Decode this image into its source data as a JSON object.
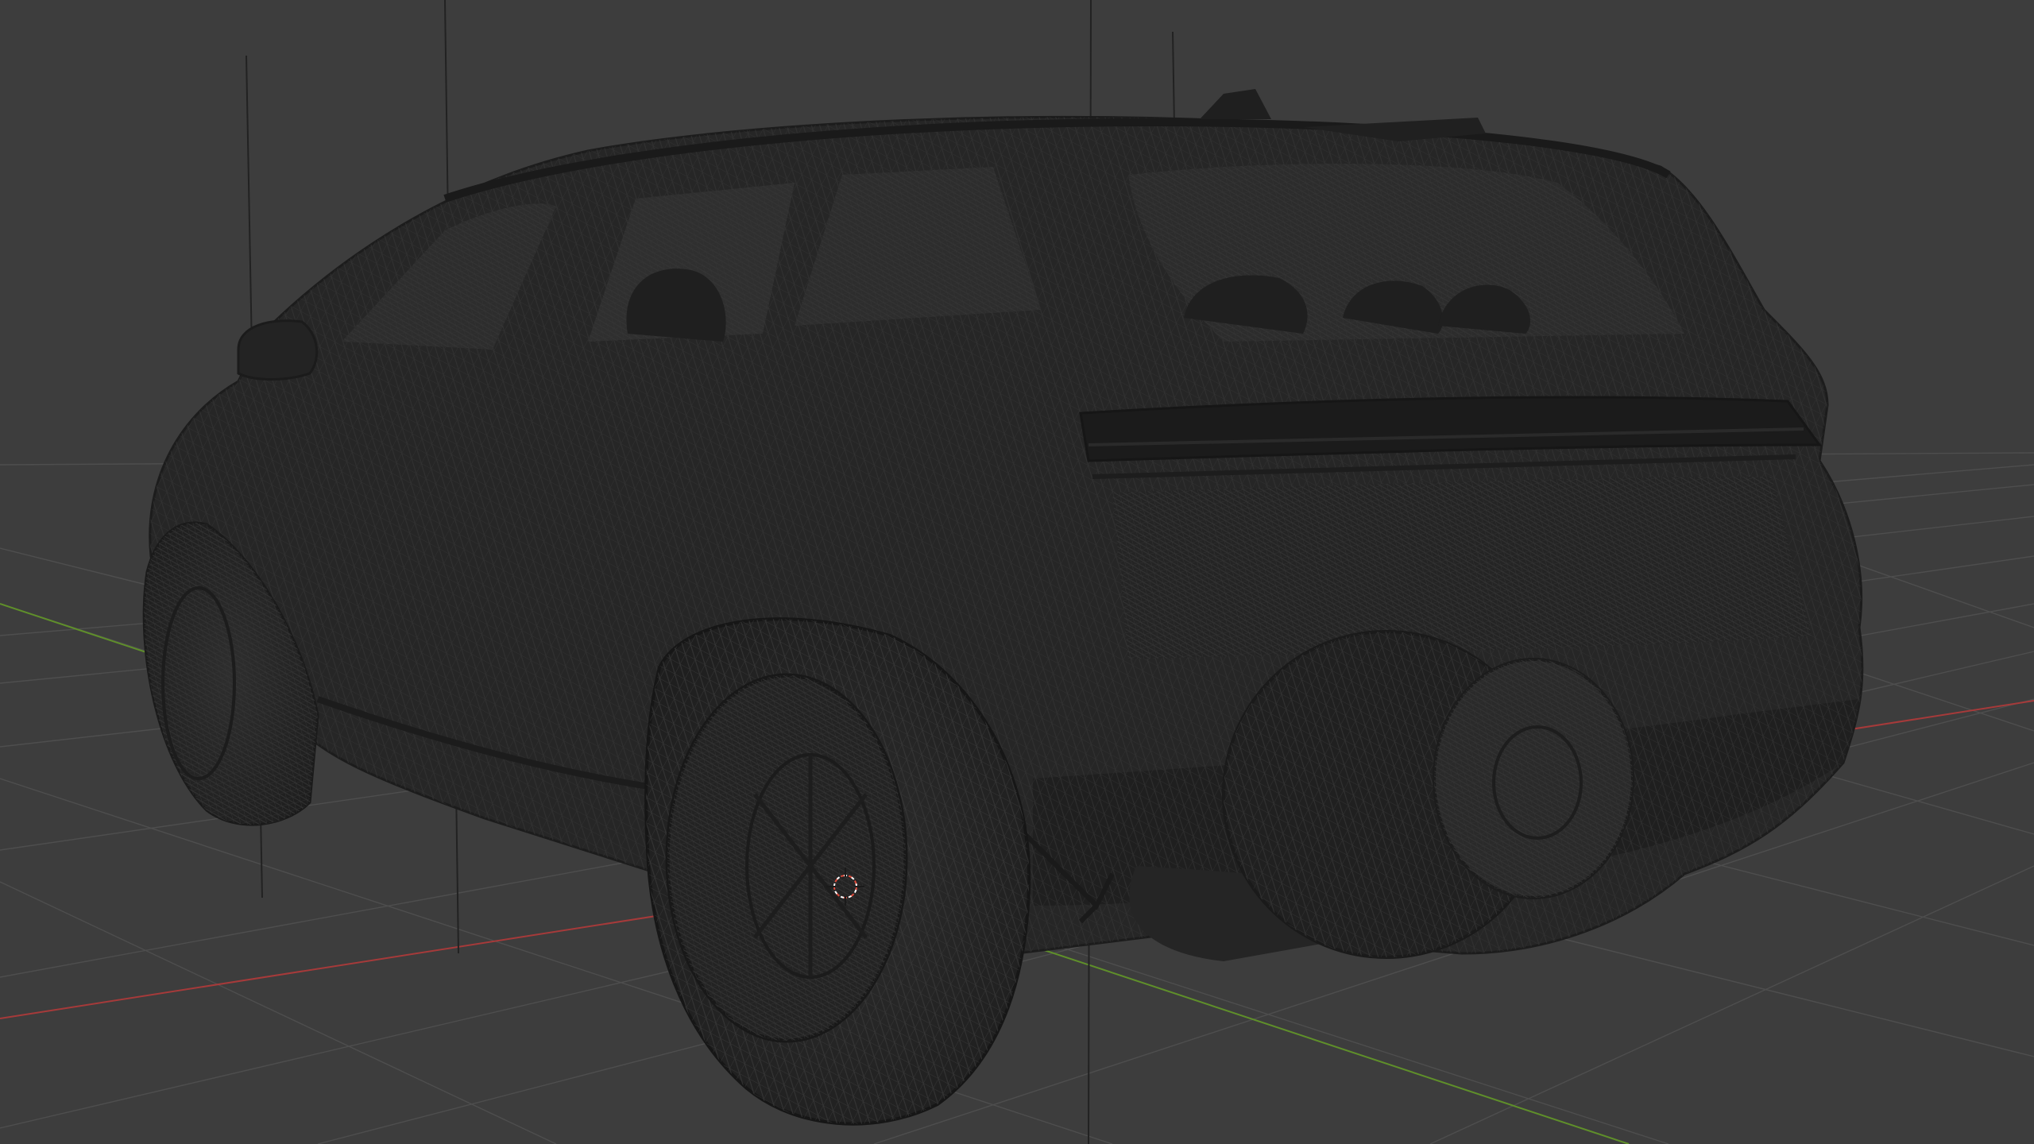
{
  "viewport": {
    "mode": "wireframe",
    "background_color": "#3d3d3d",
    "grid_color": "#4e4e4e",
    "x_axis_color": "#a63a3a",
    "y_axis_color": "#5f8f2a",
    "mesh_color": "#262626",
    "wire_color": "#3a3a3a",
    "cursor_color": "#e04a3a"
  },
  "scene": {
    "object": "suv-car-model",
    "view": "rear-three-quarter",
    "icons": {
      "cursor": "3d-cursor-icon"
    }
  }
}
